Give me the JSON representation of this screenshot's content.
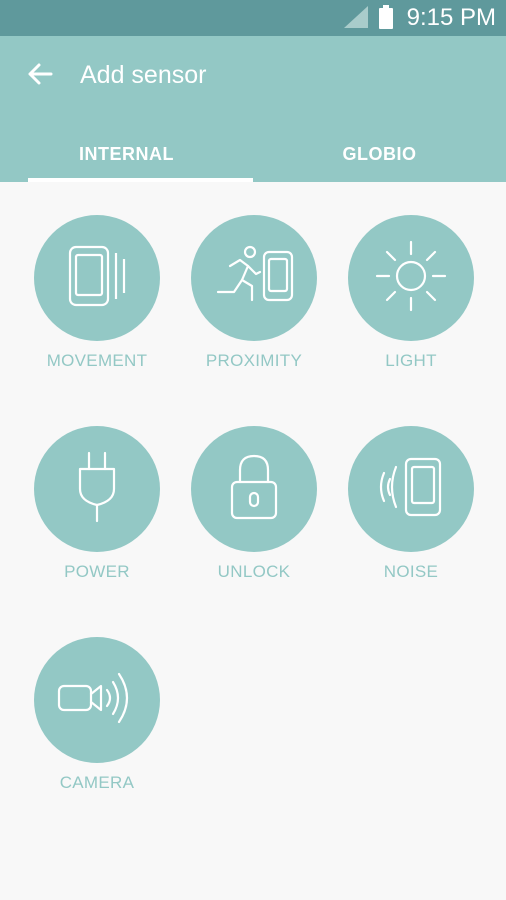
{
  "status_bar": {
    "time": "9:15 PM",
    "icons": [
      "signal-icon",
      "battery-icon"
    ]
  },
  "app_bar": {
    "title": "Add sensor",
    "back_icon": "arrow-left-icon"
  },
  "tabs": [
    {
      "label": "INTERNAL",
      "selected": true
    },
    {
      "label": "GLOBIO",
      "selected": false
    }
  ],
  "sensors": [
    {
      "label": "MOVEMENT",
      "icon": "movement-icon"
    },
    {
      "label": "PROXIMITY",
      "icon": "proximity-icon"
    },
    {
      "label": "LIGHT",
      "icon": "light-icon"
    },
    {
      "label": "POWER",
      "icon": "power-plug-icon"
    },
    {
      "label": "UNLOCK",
      "icon": "lock-icon"
    },
    {
      "label": "NOISE",
      "icon": "noise-icon"
    },
    {
      "label": "CAMERA",
      "icon": "camera-icon"
    }
  ],
  "colors": {
    "status_bar": "#5f999c",
    "accent": "#93c8c5",
    "background": "#f8f8f8",
    "on_accent": "#ffffff"
  }
}
